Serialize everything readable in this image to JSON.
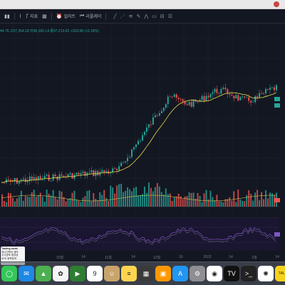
{
  "toolbar": {
    "interval_icon": "chart-interval-icon",
    "indicators_label": "지표",
    "alert_label": "얼러트",
    "replay_label": "리플레이"
  },
  "ohlc": {
    "text": "44.76  고97,264.18  저96,360.14  종97,214.62  +169.98 (+0.18%)"
  },
  "xaxis": {
    "labels": [
      "10월",
      "14",
      "11월",
      "14",
      "12월",
      "16",
      "2023",
      "14",
      "2월",
      "14"
    ]
  },
  "badge": {
    "title": "Trading cards",
    "line1": "하나인맥이 제약",
    "line2": "주식공포 종류성",
    "line3": "KRK 종목탐색"
  },
  "dock": {
    "apps": [
      {
        "name": "messages",
        "glyph": "◯",
        "color": "#34c759"
      },
      {
        "name": "mail",
        "glyph": "✉",
        "color": "#1e88e5"
      },
      {
        "name": "maps",
        "glyph": "▲",
        "color": "#4caf50"
      },
      {
        "name": "photos",
        "glyph": "✿",
        "color": "#f5f5f5"
      },
      {
        "name": "facetime",
        "glyph": "▶",
        "color": "#2e7d32"
      },
      {
        "name": "calendar",
        "glyph": "9",
        "color": "#ffffff",
        "sub": "1월"
      },
      {
        "name": "contacts",
        "glyph": "☺",
        "color": "#c8a46a"
      },
      {
        "name": "notes",
        "glyph": "≡",
        "color": "#ffd54f"
      },
      {
        "name": "launchpad",
        "glyph": "▦",
        "color": "#3a3a3a"
      },
      {
        "name": "slideshow",
        "glyph": "▣",
        "color": "#ff9800"
      },
      {
        "name": "app-store",
        "glyph": "A",
        "color": "#2196f3"
      },
      {
        "name": "system-settings",
        "glyph": "⚙",
        "color": "#8e8e93"
      },
      {
        "name": "chrome",
        "glyph": "◉",
        "color": "#ffffff"
      },
      {
        "name": "tradingview",
        "glyph": "TV",
        "color": "#111111"
      },
      {
        "name": "terminal",
        "glyph": ">_",
        "color": "#222222"
      },
      {
        "name": "chatgpt",
        "glyph": "✺",
        "color": "#ffffff"
      },
      {
        "name": "kakaotalk",
        "glyph": "TALK",
        "color": "#f7d21c"
      },
      {
        "name": "finder-extra",
        "glyph": "◌",
        "color": "#e0e0e0"
      }
    ]
  },
  "colors": {
    "up": "#26a69a",
    "down": "#ef5350",
    "ma": "#e9d94a",
    "rsi": "#7e57c2",
    "bg": "#131722"
  }
}
